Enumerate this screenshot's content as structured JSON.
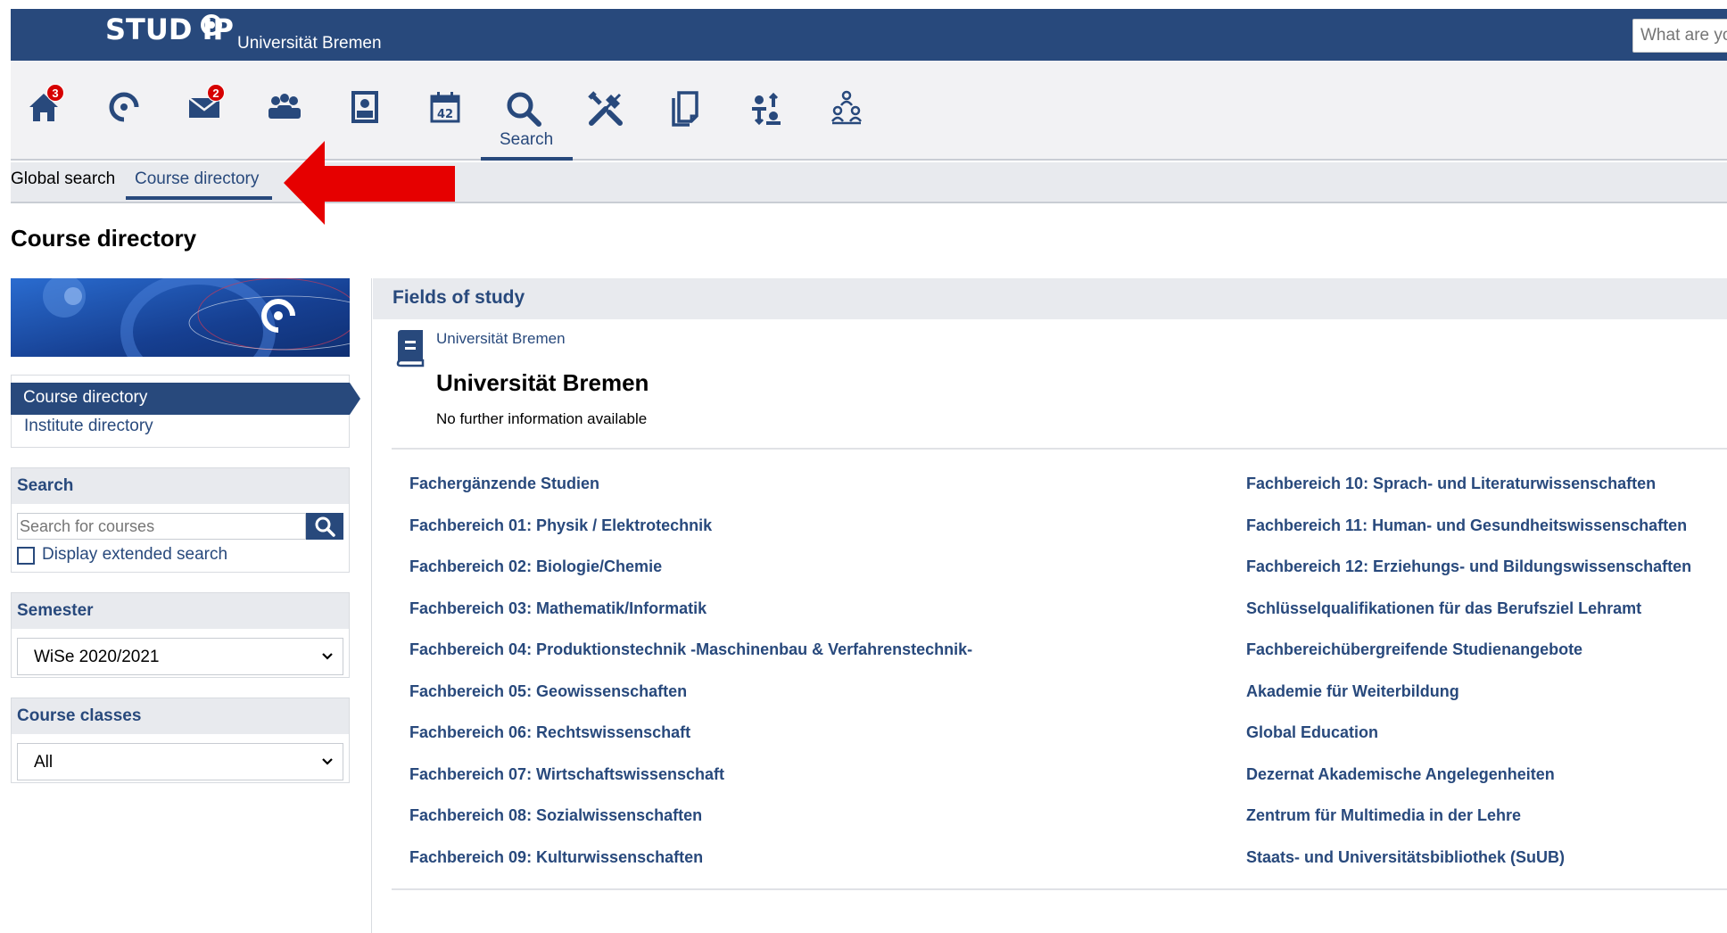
{
  "header": {
    "logo_text": "STUD IP",
    "org_name": "Universität Bremen",
    "search_placeholder": "What are you looking for?"
  },
  "nav": {
    "items": [
      {
        "name": "home-icon",
        "badge": "3"
      },
      {
        "name": "studip-ring-icon"
      },
      {
        "name": "mail-icon",
        "badge": "2"
      },
      {
        "name": "community-icon"
      },
      {
        "name": "profile-icon"
      },
      {
        "name": "calendar-icon"
      },
      {
        "name": "search-icon",
        "label": "Search",
        "active": true
      },
      {
        "name": "tools-icon"
      },
      {
        "name": "files-icon"
      },
      {
        "name": "exchange-icon"
      },
      {
        "name": "organization-icon"
      }
    ]
  },
  "subtabs": {
    "items": [
      "Global search",
      "Course directory"
    ],
    "active": "Course directory"
  },
  "page": {
    "title": "Course directory"
  },
  "sidebar": {
    "views": [
      "Course directory",
      "Institute directory"
    ],
    "search": {
      "title": "Search",
      "placeholder": "Search for courses",
      "extended_label": "Display extended search"
    },
    "semester": {
      "title": "Semester",
      "selected": "WiSe 2020/2021"
    },
    "course_classes": {
      "title": "Course classes",
      "selected": "All"
    }
  },
  "main": {
    "section_title": "Fields of study",
    "breadcrumb": "Universität Bremen",
    "title": "Universität Bremen",
    "info": "No further information available",
    "fields_left": [
      "Fachergänzende Studien",
      "Fachbereich 01: Physik / Elektrotechnik",
      "Fachbereich 02: Biologie/Chemie",
      "Fachbereich 03: Mathematik/Informatik",
      "Fachbereich 04: Produktionstechnik -Maschinenbau & Verfahrenstechnik-",
      "Fachbereich 05: Geowissenschaften",
      "Fachbereich 06: Rechtswissenschaft",
      "Fachbereich 07: Wirtschaftswissenschaft",
      "Fachbereich 08: Sozialwissenschaften",
      "Fachbereich 09: Kulturwissenschaften"
    ],
    "fields_right": [
      "Fachbereich 10: Sprach- und Literaturwissenschaften",
      "Fachbereich 11: Human- und Gesundheitswissenschaften",
      "Fachbereich 12: Erziehungs- und Bildungswissenschaften",
      "Schlüsselqualifikationen für das Berufsziel Lehramt",
      "Fachbereichübergreifende Studienangebote",
      "Akademie für Weiterbildung",
      "Global Education",
      "Dezernat Akademische Angelegenheiten",
      "Zentrum für Multimedia in der Lehre",
      "Staats- und Universitätsbibliothek (SuUB)"
    ]
  },
  "colors": {
    "brand": "#28497c",
    "badge": "#d60000",
    "annotation_arrow": "#e60000"
  }
}
